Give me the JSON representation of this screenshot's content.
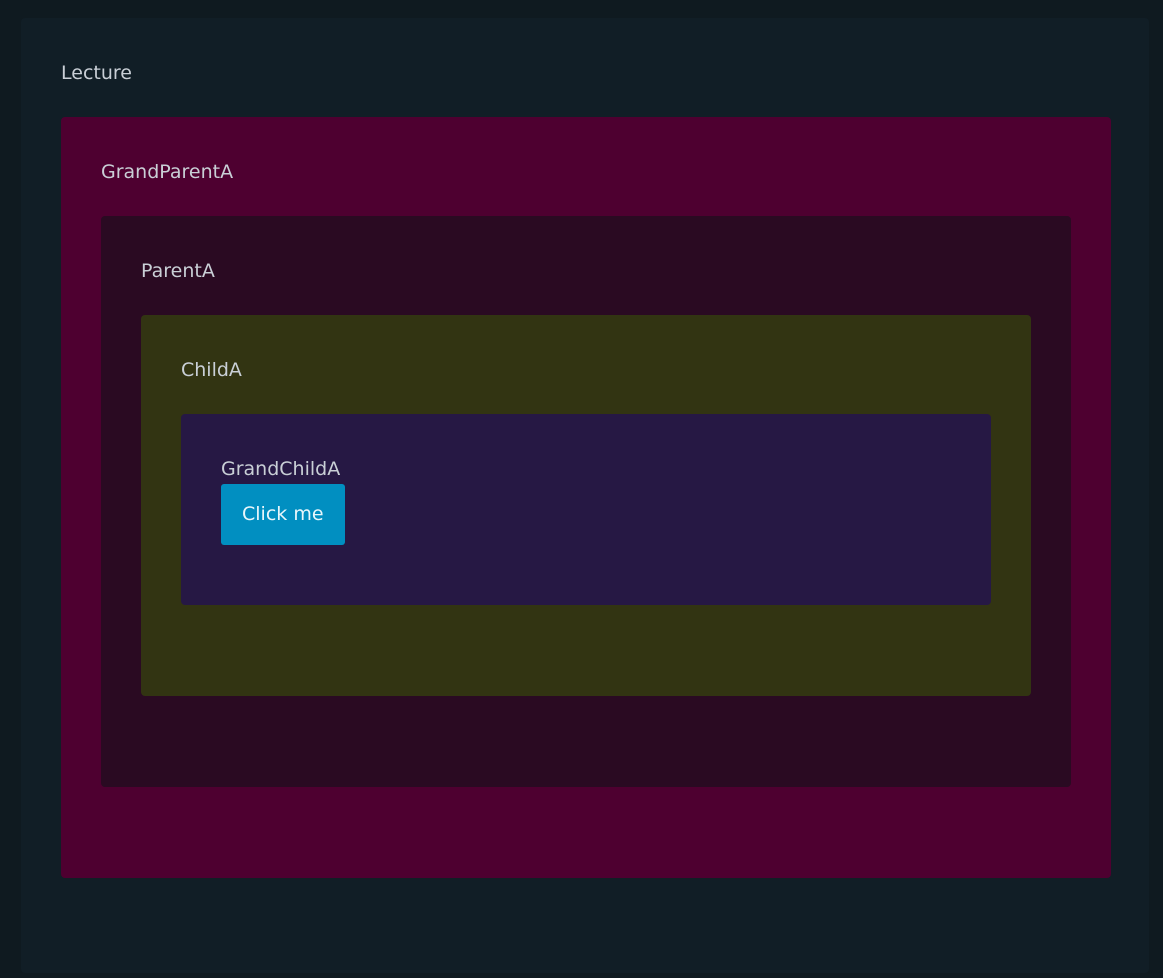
{
  "lecture": {
    "label": "Lecture",
    "grandparent": {
      "label": "GrandParentA",
      "parent": {
        "label": "ParentA",
        "child": {
          "label": "ChildA",
          "grandchild": {
            "label": "GrandChildA",
            "button_label": "Click me"
          }
        }
      }
    }
  },
  "colors": {
    "page_background": "#0f1a20",
    "lecture_background": "#111e26",
    "grandparent_background": "#4e0030",
    "parent_background": "#2a0a22",
    "child_background": "#323412",
    "grandchild_background": "#261844",
    "button_background": "#018fc1",
    "label_text": "#c9cfd6"
  }
}
